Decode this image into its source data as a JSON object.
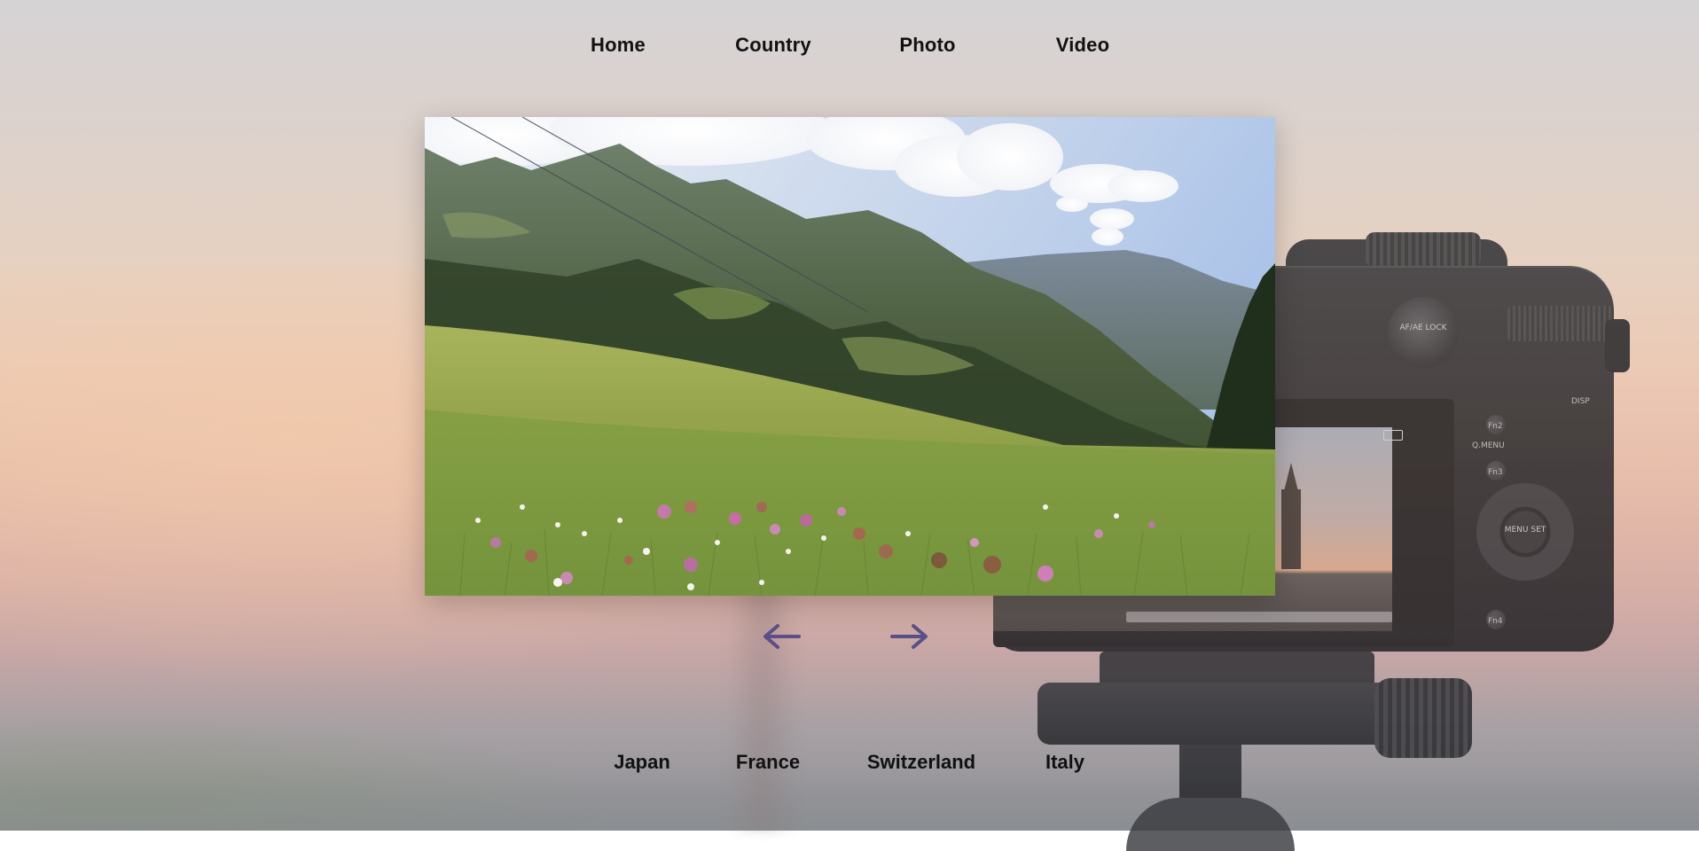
{
  "nav": {
    "items": [
      {
        "label": "Home"
      },
      {
        "label": "Country"
      },
      {
        "label": "Photo"
      },
      {
        "label": "Video"
      }
    ]
  },
  "slideshow": {
    "previous_icon": "arrow-left",
    "next_icon": "arrow-right",
    "arrow_color": "#5a4f86"
  },
  "countries": {
    "items": [
      {
        "label": "Japan"
      },
      {
        "label": "France"
      },
      {
        "label": "Switzerland"
      },
      {
        "label": "Italy"
      }
    ]
  },
  "camera": {
    "knob_label": "AF/AE LOCK",
    "wheel_label": "MENU SET",
    "button_labels": [
      "Fn2",
      "Q.MENU",
      "Fn3",
      "DISP",
      "Fn4"
    ]
  }
}
